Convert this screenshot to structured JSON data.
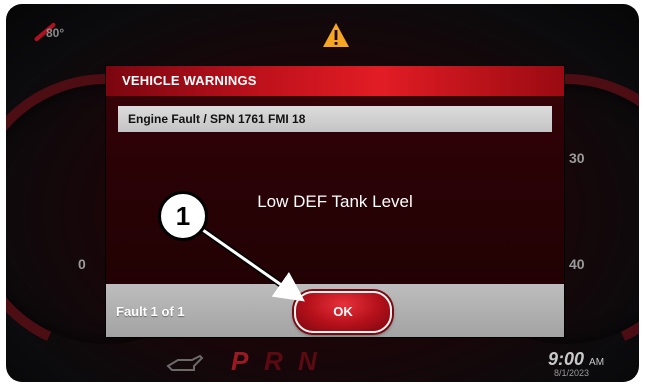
{
  "status": {
    "temperature": "80°",
    "warning_icon": "warning-triangle-icon"
  },
  "gauges": {
    "left_tick": "0",
    "right_ticks": [
      "30",
      "40"
    ]
  },
  "dialog": {
    "title": "VEHICLE WARNINGS",
    "fault_code": "Engine Fault / SPN 1761 FMI 18",
    "message": "Low DEF Tank Level",
    "fault_count": "Fault 1 of 1",
    "ok_label": "OK"
  },
  "gear_selector": {
    "gears": [
      "P",
      "R",
      "N"
    ]
  },
  "clock": {
    "time": "9:00",
    "ampm": "AM",
    "date": "8/1/2023"
  },
  "callout": {
    "number": "1"
  },
  "colors": {
    "accent": "#e21c24",
    "dialog_bg": "#2a0206",
    "footer_bg": "#a3a3a3",
    "warning": "#f5a623"
  }
}
